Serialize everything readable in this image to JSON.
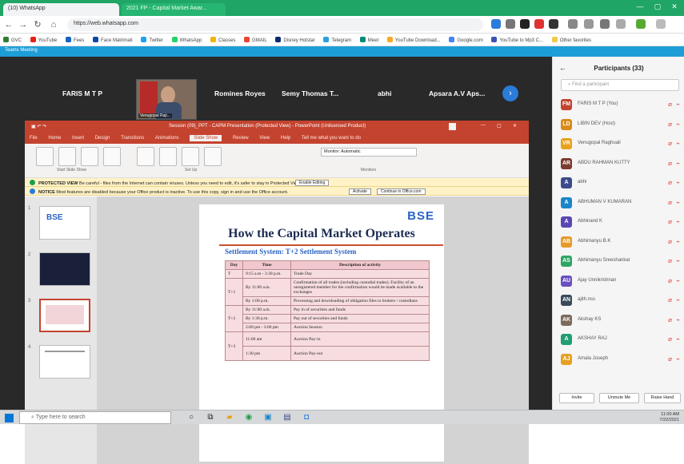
{
  "browser": {
    "tabs": [
      {
        "label": "(10) WhatsApp"
      },
      {
        "label": "2021 FP - Capital Market Awar..."
      }
    ],
    "url": "https://web.whatsapp.com",
    "bookmarks": [
      "GVC",
      "YouTube",
      "Fees",
      "Face Matrimati",
      "Twitter",
      "WhatsApp",
      "Classes",
      "GMAIL",
      "Disney Hotstar",
      "Telegram",
      "Meet",
      "YouTube Download...",
      "Google.com",
      "YouTube to Mp3 C...",
      "Other favorites"
    ]
  },
  "teams": {
    "title": "Teams Meeting",
    "participants_strip": [
      "FARIS M T P",
      "Romines Royes",
      "Semy Thomas T...",
      "abhi",
      "Apsara A.V Aps..."
    ],
    "video_label": "Venugopal Raji..."
  },
  "ppt": {
    "title": "Session (09)_PPT - CAPM Presentation (Protected View) - PowerPoint (Unlicensed Product)",
    "tabs": [
      "File",
      "Home",
      "Insert",
      "Design",
      "Transitions",
      "Animations",
      "Slide Show",
      "Review",
      "View",
      "Help",
      "Tell me what you want to do"
    ],
    "active_tab": "Slide Show",
    "ribbon_groups": [
      "Start Slide Show",
      "Set Up",
      "Monitors"
    ],
    "monitor_label": "Monitor:",
    "monitor_value": "Automatic",
    "banner1": {
      "label": "PROTECTED VIEW",
      "text": "Be careful - files from the Internet can contain viruses. Unless you need to edit, it's safer to stay in Protected View.",
      "button": "Enable Editing"
    },
    "banner2": {
      "label": "NOTICE",
      "text": "Most features are disabled because your Office product is inactive. To use this copy, sign in and use the Office account.",
      "button1": "Activate",
      "button2": "Continue in Office.com"
    }
  },
  "slide": {
    "logo": "BSE",
    "title": "How the Capital Market Operates",
    "subtitle": "Settlement System: T+2 Settlement System",
    "headers": [
      "Day",
      "Time",
      "Description of activity"
    ],
    "rows": [
      {
        "day": "T",
        "time": "9:15 a.m - 3:30 p.m.",
        "desc": "Trade Day"
      },
      {
        "day": "T+1",
        "time": "By 11:00 a.m.",
        "desc": "Confirmation of all trades (including custodial trades). Facility of an unregistered member for the confirmation would be made available to the exchanges"
      },
      {
        "day": "",
        "time": "By 1:00 p.m.",
        "desc": "Processing and downloading of obligation files to brokers / custodians"
      },
      {
        "day": "T+2",
        "time": "By 11:00 a.m.",
        "desc": "Pay in of securities and funds"
      },
      {
        "day": "",
        "time": "By 1:30 p.m.",
        "desc": "Pay out of securities and funds"
      },
      {
        "day": "",
        "time": "2:00 pm - 3:00 pm",
        "desc": "Auction Session"
      },
      {
        "day": "T+3",
        "time": "11:00 am",
        "desc": "Auction Pay-in"
      },
      {
        "day": "",
        "time": "1:30 pm",
        "desc": "Auction Pay-out"
      }
    ]
  },
  "panel": {
    "title": "Participants (33)",
    "search_placeholder": "Find a participant",
    "people": [
      {
        "name": "FARIS M T P (You)",
        "initials": "FM",
        "color": "#c4432f"
      },
      {
        "name": "LIBIN DEV (Host)",
        "initials": "LD",
        "color": "#d98a17"
      },
      {
        "name": "Venugopal Raghuali",
        "initials": "VR",
        "color": "#e8a21c"
      },
      {
        "name": "ABDU RAHMAN KUTTY",
        "initials": "AR",
        "color": "#7c3b2f"
      },
      {
        "name": "abhi",
        "initials": "A",
        "color": "#3b4b8c"
      },
      {
        "name": "ABHUMAN V KUMARAN",
        "initials": "A",
        "color": "#1a86c8"
      },
      {
        "name": "Abhinand K",
        "initials": "A",
        "color": "#5b47b3"
      },
      {
        "name": "Abhimanyu B.K",
        "initials": "AB",
        "color": "#e59b2a"
      },
      {
        "name": "Abhimanyu Sreeshankar",
        "initials": "AS",
        "color": "#2ea566"
      },
      {
        "name": "Ajay Unnikrishnan",
        "initials": "AU",
        "color": "#6a4fc0"
      },
      {
        "name": "ajith.nss",
        "initials": "AN",
        "color": "#3b4b5c"
      },
      {
        "name": "Akshay KS",
        "initials": "AK",
        "color": "#7d6a5c"
      },
      {
        "name": "AKSHAY RAJ",
        "initials": "A",
        "color": "#1f9e73"
      },
      {
        "name": "Amala Joseph",
        "initials": "AJ",
        "color": "#e6a123"
      }
    ],
    "buttons": [
      "Invite",
      "Unmute Me",
      "Raise Hand"
    ]
  },
  "taskbar": {
    "search_placeholder": "Type here to search",
    "time": "11:00 AM",
    "date": "7/22/2021"
  },
  "colors": {
    "teams_green": "#1fa565",
    "ppt_red": "#c4432f",
    "teams_blue": "#1e9ed7"
  }
}
